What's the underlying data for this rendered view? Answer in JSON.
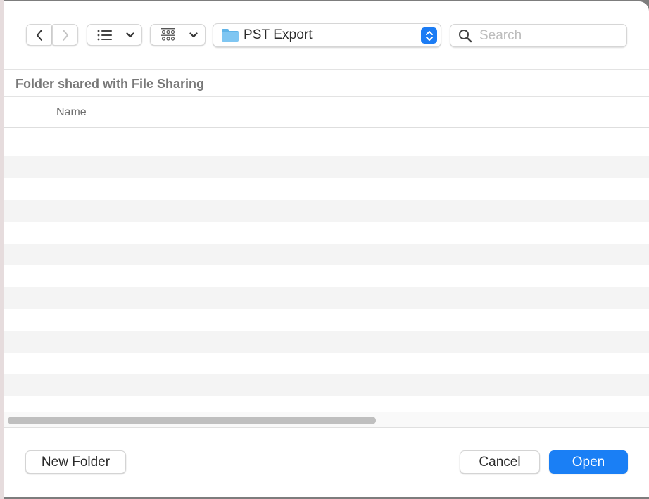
{
  "toolbar": {
    "back_icon": "chevron-left-icon",
    "forward_icon": "chevron-right-icon",
    "view_mode_icon": "list-view-icon",
    "group_icon": "group-grid-icon",
    "location": {
      "label": "PST Export",
      "icon": "folder-icon",
      "stepper_icon": "up-down-chevron-icon"
    },
    "search": {
      "placeholder": "Search",
      "value": "",
      "icon": "search-icon"
    }
  },
  "section": {
    "title": "Folder shared with File Sharing"
  },
  "file_list": {
    "columns": [
      "Name"
    ],
    "rows": []
  },
  "footer": {
    "new_folder_label": "New Folder",
    "cancel_label": "Cancel",
    "open_label": "Open"
  },
  "colors": {
    "accent": "#1a7ff5",
    "alt_row": "#f4f4f4",
    "section_title": "#777777"
  }
}
